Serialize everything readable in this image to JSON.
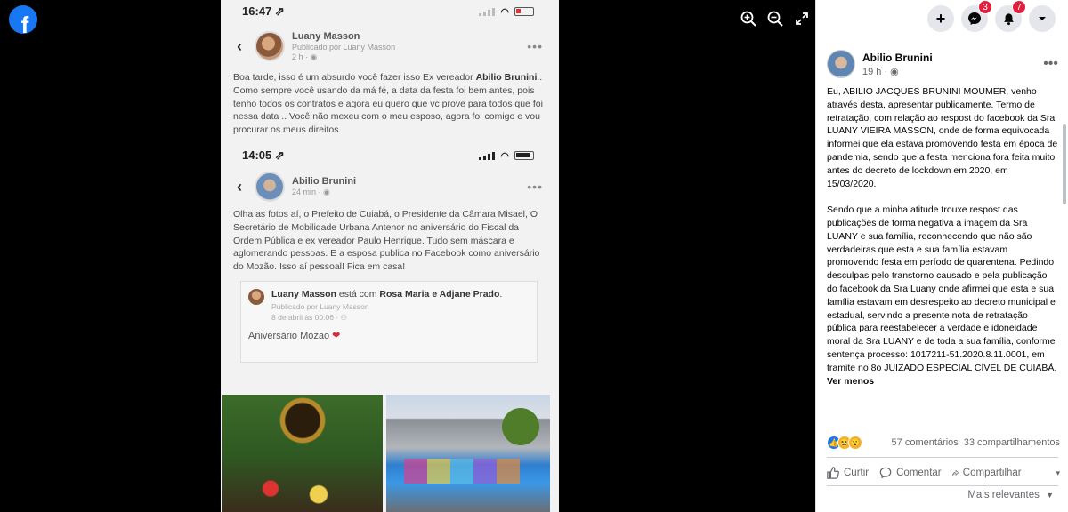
{
  "viewer": {
    "zoom_in_icon": "zoom-in-icon",
    "zoom_out_icon": "zoom-out-icon",
    "fullscreen_icon": "expand-icon"
  },
  "screenshot": {
    "status1": {
      "time": "16:47 ⇗"
    },
    "post1": {
      "author": "Luany Masson",
      "sub1": "Publicado por Luany Masson",
      "sub2": "2 h · ◉",
      "text_a": "Boa tarde, isso é um absurdo você fazer isso  Ex vereador ",
      "text_b": "Abilio Brunini",
      "text_c": ".. Como sempre você usando da má fé, a data da festa foi bem antes, pois tenho todos os contratos e agora eu quero que vc prove para todos que foi nessa data .. Você não mexeu com o meu esposo, agora foi comigo e vou procurar os meus direitos."
    },
    "status2": {
      "time": "14:05 ⇗"
    },
    "post2": {
      "author": "Abilio Brunini",
      "sub": "24 min · ◉",
      "text": "Olha as fotos aí, o Prefeito de Cuiabá, o Presidente da Câmara Misael, O Secretário de Mobilidade Urbana Antenor no aniversário do Fiscal da Ordem Pública e ex vereador Paulo Henrique. Tudo sem máscara e aglomerando pessoas. E a esposa publica no Facebook como aniversário do Mozão. Isso aí pessoal! Fica em casa!"
    },
    "shared": {
      "name": "Luany Masson",
      "mid": " está com ",
      "with": "Rosa Maria e Adjane Prado",
      "end": ".",
      "sub1": "Publicado por Luany Masson",
      "sub2": "8 de abril às 00:06 · ⚇",
      "caption": "Aniversário Mozao ",
      "heart": "❤"
    }
  },
  "header": {
    "create_icon": "plus-icon",
    "messenger_icon": "messenger-icon",
    "messenger_badge": "3",
    "notifications_icon": "bell-icon",
    "notifications_badge": "7",
    "account_icon": "caret-down-icon"
  },
  "post": {
    "author": "Abilio Brunini",
    "time": "19 h · ◉",
    "paragraph1": "Eu, ABILIO JACQUES BRUNINI MOUMER, venho através desta, apresentar publicamente. Termo de retratação, com relação ao respost do facebook da Sra LUANY VIEIRA MASSON, onde de forma equivocada informei que ela estava promovendo festa em época de pandemia, sendo que a festa menciona fora feita muito antes do decreto de lockdown em 2020, em 15/03/2020.",
    "paragraph2": "Sendo que a minha atitude trouxe respost das publicações de forma negativa a imagem da Sra LUANY e sua família, reconhecendo que não são verdadeiras que esta e sua família estavam promovendo festa em período de quarentena. Pedindo desculpas pelo transtorno causado e pela publicação do facebook da Sra Luany onde afirmei que esta e sua família estavam em desrespeito ao decreto municipal e estadual, servindo a presente nota de retratação pública para reestabelecer a verdade e idoneidade moral da Sra LUANY e de toda a sua família, conforme sentença processo: 1017211-51.2020.8.11.0001, em tramite no 8o JUIZADO ESPECIAL CÍVEL DE CUIABÁ. ",
    "see_more": "Ver menos",
    "comments": "57 comentários",
    "shares": "33 compartilhamentos",
    "actions": {
      "like": "Curtir",
      "comment": "Comentar",
      "share": "Compartilhar"
    },
    "sort": "Mais relevantes"
  }
}
